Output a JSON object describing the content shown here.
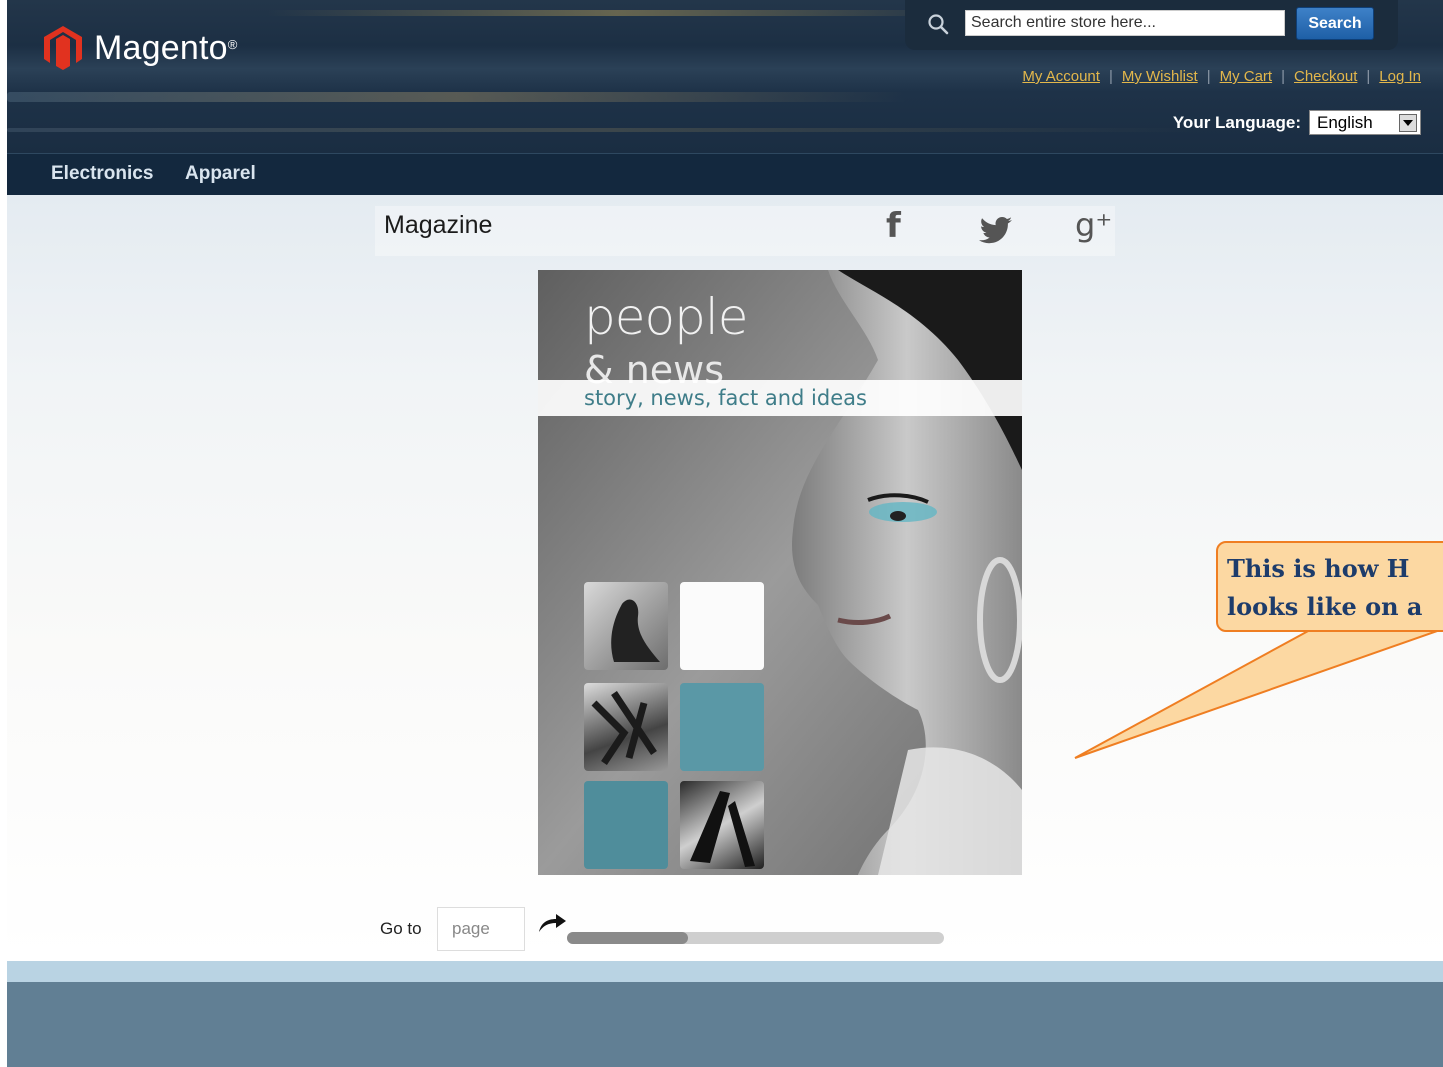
{
  "header": {
    "brand": "Magento",
    "brand_mark": "®",
    "search": {
      "placeholder": "Search entire store here...",
      "button": "Search"
    },
    "links": [
      "My Account",
      "My Wishlist",
      "My Cart",
      "Checkout",
      "Log In"
    ],
    "language": {
      "label": "Your Language:",
      "selected": "English"
    }
  },
  "nav": {
    "items": [
      "Electronics",
      "Apparel"
    ]
  },
  "magazine": {
    "title": "Magazine",
    "social": [
      "facebook-icon",
      "twitter-icon",
      "google-plus-icon"
    ],
    "social_glyphs": [
      "f",
      "🐦",
      "g⁺"
    ],
    "cover": {
      "title": "people",
      "subtitle": "& news",
      "tagline": "story, news, fact and ideas"
    },
    "goto": {
      "label": "Go to",
      "placeholder": "page"
    },
    "scroll_position": 0.32
  },
  "callout": {
    "line1": "This is how H",
    "line2": "looks like on a"
  },
  "colors": {
    "accent": "#ef7e22",
    "link": "#e3b74b",
    "nav_bg": "#13283e",
    "footer": "#617f94"
  }
}
